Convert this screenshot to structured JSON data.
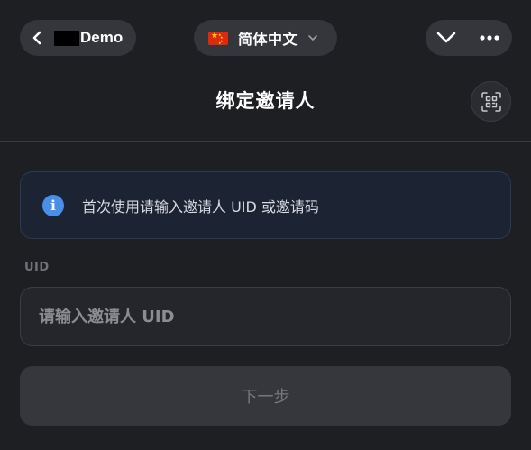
{
  "header": {
    "back_label": "Demo",
    "language": {
      "label": "简体中文",
      "flag_icon": "cn-flag-icon"
    },
    "icons": {
      "back": "chevron-left-icon",
      "caret": "chevron-down-icon",
      "collapse": "chevron-down-icon",
      "more": "more-dots-icon"
    }
  },
  "page": {
    "title": "绑定邀请人",
    "scan_icon": "qr-scan-icon"
  },
  "info_banner": {
    "icon": "info-icon",
    "icon_glyph": "i",
    "text": "首次使用请输入邀请人 UID 或邀请码"
  },
  "form": {
    "uid_label": "UID",
    "uid_placeholder": "请输入邀请人 UID",
    "uid_value": ""
  },
  "actions": {
    "next_label": "下一步"
  },
  "colors": {
    "background": "#1e1f23",
    "pill": "#35363b",
    "info_bg": "#1c2333",
    "info_icon": "#4a8fe7",
    "button_disabled": "#36373c"
  }
}
